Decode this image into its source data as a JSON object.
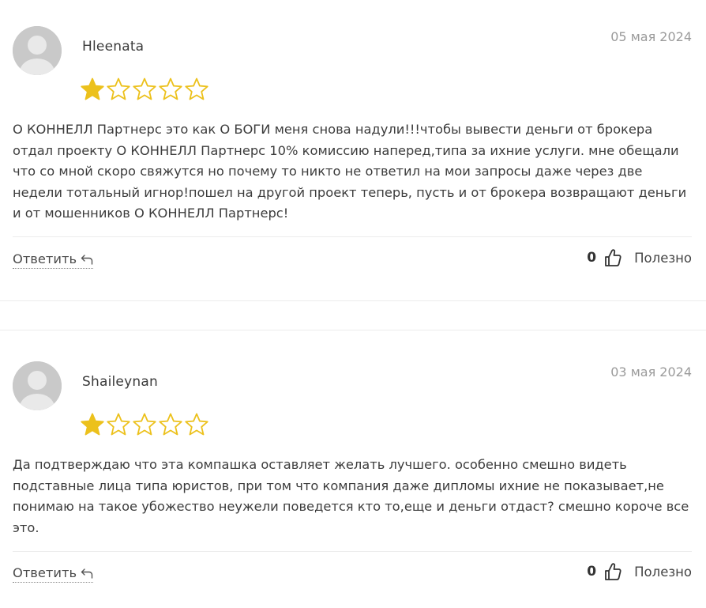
{
  "colors": {
    "star_filled": "#ecc11c",
    "star_empty_stroke": "#ecc11c",
    "avatar_bg": "#c9c9c9"
  },
  "reviews": [
    {
      "author": "Hleenata",
      "date": "05 мая 2024",
      "rating": 1,
      "max_rating": 5,
      "text": "О КОННЕЛЛ Партнерс это как О БОГИ меня снова надули!!!чтобы вывести деньги от брокера отдал проекту О КОННЕЛЛ Партнерс 10% комиссию наперед,типа за ихние услуги. мне обещали что со мной скоро свяжутся но почему то никто не ответил на мои запросы даже через две недели тотальный игнор!пошел на другой проект теперь, пусть и от брокера возвращают деньги и от мошенников О КОННЕЛЛ Партнерс!",
      "reply_label": "Ответить",
      "helpful_count": "0",
      "helpful_label": "Полезно",
      "avatar_icon": "user-silhouette-icon"
    },
    {
      "author": "Shaileynan",
      "date": "03 мая 2024",
      "rating": 1,
      "max_rating": 5,
      "text": "Да подтверждаю что эта компашка оставляет желать лучшего. особенно смешно видеть подставные лица типа юристов, при том что компания даже дипломы ихние не показывает,не понимаю на такое убожество неужели поведется кто то,еще и деньги отдаст? смешно короче все это.",
      "reply_label": "Ответить",
      "helpful_count": "0",
      "helpful_label": "Полезно",
      "avatar_icon": "user-silhouette-icon"
    }
  ]
}
